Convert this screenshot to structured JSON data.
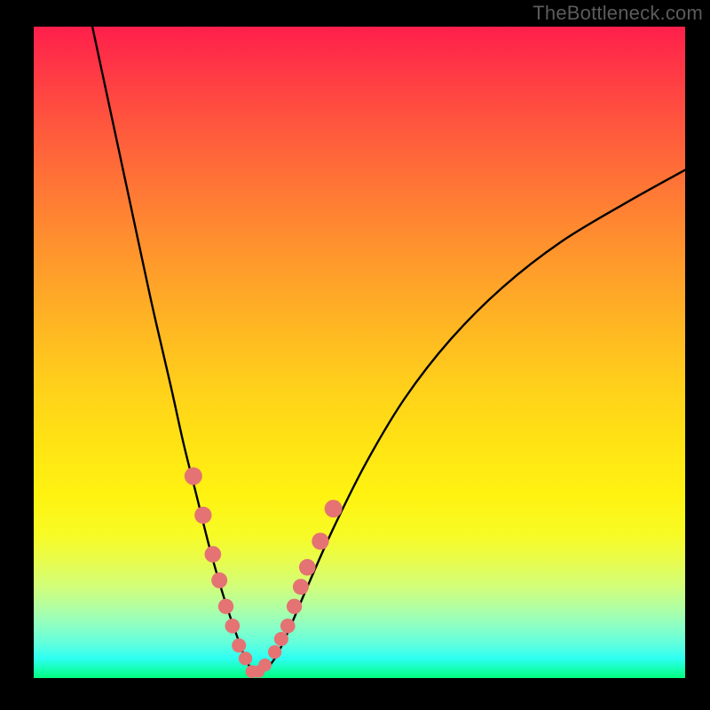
{
  "attribution": "TheBottleneck.com",
  "colors": {
    "page_bg": "#000000",
    "gradient_top": "#ff1f4b",
    "gradient_bottom": "#00ff7f",
    "curve": "#000000",
    "marker_fill": "#e57373",
    "marker_stroke": "#c94f4f",
    "text": "#5b5b5b"
  },
  "chart_data": {
    "type": "line",
    "title": "",
    "xlabel": "",
    "ylabel": "",
    "xlim": [
      0,
      100
    ],
    "ylim": [
      0,
      100
    ],
    "note": "Axes are unlabeled in the source image; x and y are treated as normalized 0–100. The curve resembles a bottleneck V-shape reaching ~0 near x≈33 and rising on both sides. Pink markers highlight a subset of points along the low portion of the curve.",
    "series": [
      {
        "name": "bottleneck-curve",
        "x": [
          9,
          12,
          15,
          18,
          21,
          23,
          25,
          27,
          29,
          31,
          33,
          35,
          37,
          39,
          42,
          46,
          51,
          57,
          64,
          72,
          81,
          91,
          100
        ],
        "y": [
          100,
          86,
          72,
          58,
          45,
          36,
          28,
          20,
          13,
          7,
          2,
          1,
          3,
          7,
          14,
          23,
          33,
          43,
          52,
          60,
          67,
          73,
          78
        ]
      },
      {
        "name": "highlight-markers",
        "x": [
          24.5,
          26.0,
          27.5,
          28.5,
          29.5,
          30.5,
          31.5,
          32.5,
          33.5,
          34.5,
          35.5,
          37.0,
          38.0,
          39.0,
          40.0,
          41.0,
          42.0,
          44.0,
          46.0
        ],
        "y": [
          31,
          25,
          19,
          15,
          11,
          8,
          5,
          3,
          1,
          1,
          2,
          4,
          6,
          8,
          11,
          14,
          17,
          21,
          26
        ]
      }
    ]
  }
}
